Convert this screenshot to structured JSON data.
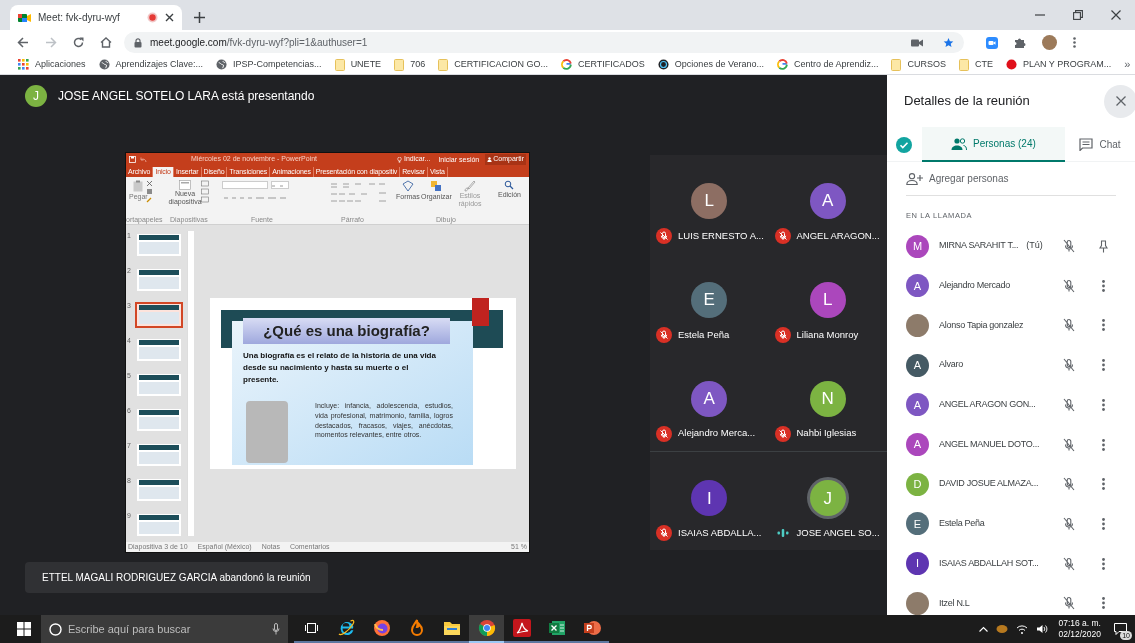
{
  "browser": {
    "tab": {
      "title": "Meet: fvk-dyru-wyf"
    },
    "url": {
      "host": "meet.google.com",
      "path": "/fvk-dyru-wyf?pli=1&authuser=1"
    },
    "bookmarks": [
      {
        "kind": "apps",
        "label": "Aplicaciones"
      },
      {
        "kind": "globe",
        "label": "Aprendizajes Clave:..."
      },
      {
        "kind": "globe",
        "label": "IPSP-Competencias..."
      },
      {
        "kind": "folder",
        "label": "UNETE"
      },
      {
        "kind": "folder",
        "label": "706"
      },
      {
        "kind": "folder",
        "label": "CERTIFICACION GO..."
      },
      {
        "kind": "google",
        "label": "CERTIFICADOS"
      },
      {
        "kind": "ring",
        "label": "Opciones de Verano..."
      },
      {
        "kind": "google",
        "label": "Centro de Aprendiz..."
      },
      {
        "kind": "folder",
        "label": "CURSOS"
      },
      {
        "kind": "folder",
        "label": "CTE"
      },
      {
        "kind": "dot",
        "label": "PLAN Y PROGRAM..."
      }
    ],
    "more": "»"
  },
  "meet": {
    "presenter": {
      "initial": "J",
      "color": "#7cb342",
      "text": "JOSE ANGEL SOTELO LARA está presentando"
    },
    "presentation": {
      "title": "Miércoles 02 de noviembre - PowerPoint",
      "tabs": [
        {
          "label": "Archivo",
          "selected": false
        },
        {
          "label": "Inicio",
          "selected": true
        },
        {
          "label": "Insertar",
          "selected": false
        },
        {
          "label": "Diseño",
          "selected": false
        },
        {
          "label": "Transiciones",
          "selected": false
        },
        {
          "label": "Animaciones",
          "selected": false
        },
        {
          "label": "Presentación con diapositiv",
          "selected": false
        },
        {
          "label": "Revisar",
          "selected": false
        },
        {
          "label": "Vista",
          "selected": false
        }
      ],
      "commands": {
        "tell": "Indicar...",
        "signin": "Iniciar sesión",
        "share": "Compartir"
      },
      "ribbon_buttons": [
        "Pegar",
        "Nueva diapositiva",
        "Formas",
        "Organizar",
        "Estilos rápidos",
        "Edición"
      ],
      "ribbon_groups": [
        "ortapapeles",
        "Diapositivas",
        "Fuente",
        "Párrafo",
        "Dibujo"
      ],
      "thumbnails": [
        {
          "number": "1",
          "selected": false
        },
        {
          "number": "2",
          "selected": false
        },
        {
          "number": "3",
          "selected": true
        },
        {
          "number": "4",
          "selected": false
        },
        {
          "number": "5",
          "selected": false
        },
        {
          "number": "6",
          "selected": false
        },
        {
          "number": "7",
          "selected": false
        },
        {
          "number": "8",
          "selected": false
        },
        {
          "number": "9",
          "selected": false
        }
      ],
      "slide": {
        "title": "¿Qué es una biografía?",
        "lead": "Una biografía es el relato de la historia de una vida desde su nacimiento y hasta su muerte o el presente.",
        "detail": "Incluye: infancia, adolescencia, estudios, vida profesional, matrimonio, familia, logros destacados, fracasos, viajes, anécdotas, momentos relevantes, entre otros."
      },
      "status": [
        "Diapositiva 3 de 10",
        "Español (México)",
        "Notas",
        "Comentarios",
        "51 %"
      ]
    },
    "tiles": [
      {
        "initial": "L",
        "color": "#8d6e63",
        "name": "LUIS ERNESTO A...",
        "muted": true
      },
      {
        "initial": "A",
        "color": "#7e57c2",
        "name": "ANGEL ARAGON...",
        "muted": true
      },
      {
        "initial": "E",
        "color": "#546e7a",
        "name": "Estela Peña",
        "muted": true
      },
      {
        "initial": "L",
        "color": "#ab47bc",
        "name": "Liliana Monroy",
        "muted": true
      },
      {
        "initial": "A",
        "color": "#7e57c2",
        "name": "Alejandro Merca...",
        "muted": true
      },
      {
        "initial": "N",
        "color": "#7cb342",
        "name": "Nahbi Iglesias",
        "muted": true
      },
      {
        "initial": "I",
        "color": "#5e35b1",
        "name": "ISAIAS ABDALLA...",
        "muted": true
      },
      {
        "initial": "J",
        "color": "#7cb342",
        "name": "JOSE ANGEL SO...",
        "muted": false
      }
    ],
    "toast": "ETTEL MAGALI RODRIGUEZ GARCIA abandonó la reunión"
  },
  "panel": {
    "title": "Detalles de la reunión",
    "tabs": [
      {
        "kind": "info",
        "selected": false
      },
      {
        "kind": "people",
        "label": "Personas (24)",
        "selected": true
      },
      {
        "kind": "chat",
        "label": "Chat",
        "selected": false
      }
    ],
    "add": "Agregar personas",
    "section": "EN LA LLAMADA",
    "participants": [
      {
        "kind": "self",
        "initial": "M",
        "color": "#ab47bc",
        "name": "MIRNA SARAHIT T...",
        "you": "(Tú)",
        "muted": true
      },
      {
        "kind": "member",
        "initial": "A",
        "color": "#7e57c2",
        "name": "Alejandro Mercado",
        "muted": true
      },
      {
        "kind": "member",
        "name": "Alonso Tapia gonzalez",
        "muted": true
      },
      {
        "kind": "member",
        "initial": "A",
        "color": "#455a64",
        "name": "Alvaro",
        "muted": true
      },
      {
        "kind": "member",
        "initial": "A",
        "color": "#7e57c2",
        "name": "ANGEL ARAGON GON...",
        "muted": true
      },
      {
        "kind": "member",
        "initial": "A",
        "color": "#ab47bc",
        "name": "ANGEL MANUEL DOTO...",
        "muted": true
      },
      {
        "kind": "member",
        "initial": "D",
        "color": "#7cb342",
        "name": "DAVID JOSUE ALMAZA...",
        "muted": true
      },
      {
        "kind": "member",
        "initial": "E",
        "color": "#546e7a",
        "name": "Estela Peña",
        "muted": true
      },
      {
        "kind": "member",
        "initial": "I",
        "color": "#5e35b1",
        "name": "ISAIAS ABDALLAH SOT...",
        "muted": true
      },
      {
        "kind": "member",
        "name": "Itzel N.L",
        "muted": true
      }
    ]
  },
  "taskbar": {
    "search": {
      "placeholder": "Escribe aquí para buscar"
    },
    "apps": [
      {
        "kind": "taskview",
        "active": false
      },
      {
        "kind": "ie",
        "active": false
      },
      {
        "kind": "firefox",
        "active": false
      },
      {
        "kind": "flame",
        "active": false
      },
      {
        "kind": "explorer",
        "active": false
      },
      {
        "kind": "chrome",
        "active": true
      },
      {
        "kind": "acrobat",
        "active": false
      },
      {
        "kind": "excel",
        "active": false
      },
      {
        "kind": "powerpoint",
        "active": false
      }
    ],
    "time": "07:16 a. m.",
    "date": "02/12/2020",
    "notifications": "10"
  }
}
